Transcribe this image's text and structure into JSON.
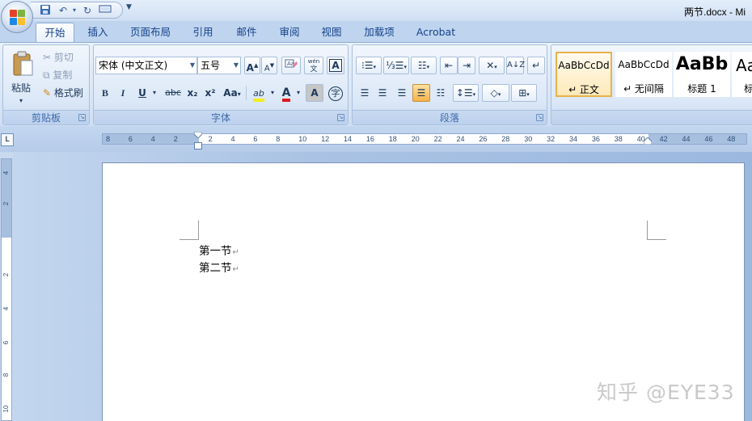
{
  "window": {
    "title": "两节.docx - Mi"
  },
  "tabs": [
    "开始",
    "插入",
    "页面布局",
    "引用",
    "邮件",
    "审阅",
    "视图",
    "加载项",
    "Acrobat"
  ],
  "clipboard": {
    "paste": "粘贴",
    "cut": "剪切",
    "copy": "复制",
    "format_painter": "格式刷",
    "label": "剪贴板"
  },
  "font": {
    "face": "宋体 (中文正文)",
    "size": "五号",
    "label": "字体",
    "bold": "B",
    "italic": "I",
    "underline": "U",
    "strike": "abc",
    "sub": "x₂",
    "sup": "x²",
    "case": "Aa",
    "highlight": "ab",
    "color": "A",
    "grow": "A",
    "shrink": "A",
    "char_border": "A",
    "enclose": "字",
    "phonetic": "wén"
  },
  "paragraph": {
    "label": "段落"
  },
  "styles": {
    "tiles": [
      {
        "sample": "AaBbCcDd",
        "name": "↵ 正文"
      },
      {
        "sample": "AaBbCcDd",
        "name": "↵ 无间隔"
      },
      {
        "sample": "AaBb",
        "name": "标题 1"
      },
      {
        "sample": "Aa",
        "name": "标"
      }
    ]
  },
  "ruler": {
    "h_labels": [
      "8",
      "6",
      "4",
      "2",
      "2",
      "4",
      "6",
      "8",
      "10",
      "12",
      "14",
      "16",
      "18",
      "20",
      "22",
      "24",
      "26",
      "28",
      "30",
      "32",
      "34",
      "36",
      "38",
      "40",
      "42",
      "44",
      "46",
      "48"
    ],
    "v_labels": [
      "4",
      "2",
      "2",
      "4",
      "6",
      "8",
      "10"
    ]
  },
  "document": {
    "lines": [
      "第一节",
      "第二节"
    ]
  },
  "watermark": "知乎 @EYE33"
}
